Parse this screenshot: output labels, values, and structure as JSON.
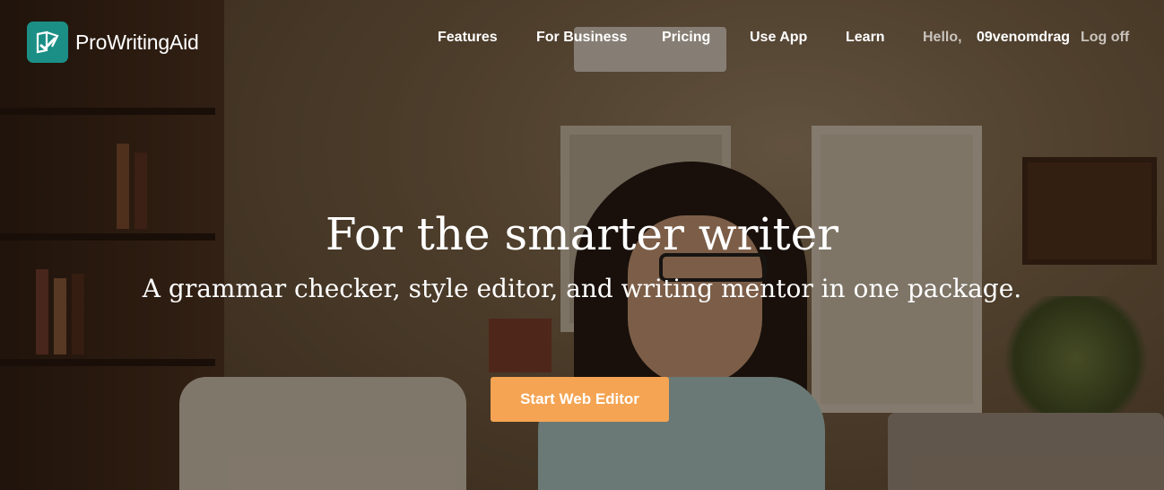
{
  "brand": {
    "name": "ProWritingAid",
    "color": "#1b8f86"
  },
  "nav": {
    "items": [
      {
        "label": "Features"
      },
      {
        "label": "For Business"
      },
      {
        "label": "Pricing"
      },
      {
        "label": "Use App"
      },
      {
        "label": "Learn"
      }
    ],
    "greeting": "Hello,",
    "username": "09venomdrag",
    "logoff": "Log off"
  },
  "hero": {
    "headline": "For the smarter writer",
    "subhead": "A grammar checker, style editor, and writing mentor in one package.",
    "cta_label": "Start Web Editor",
    "cta_color": "#f4a453",
    "background_image": "woman-smiling-at-laptop-photo"
  }
}
